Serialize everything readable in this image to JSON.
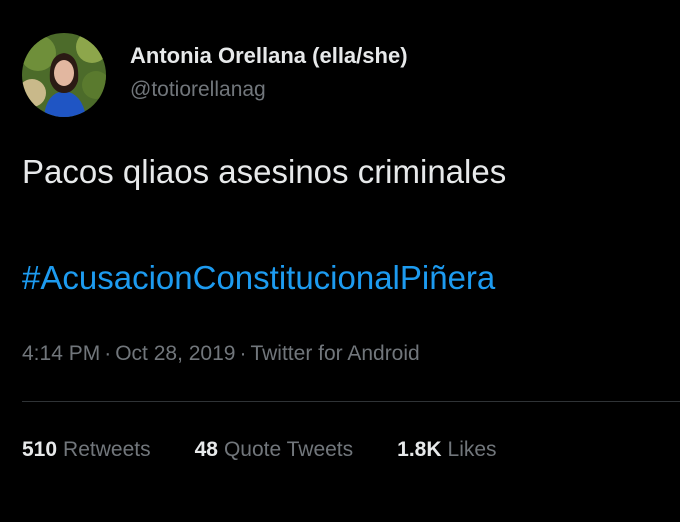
{
  "tweet": {
    "author": {
      "display_name": "Antonia Orellana (ella/she)",
      "handle": "@totiorellanag",
      "avatar_icon": "profile-photo"
    },
    "text": "Pacos qliaos asesinos criminales",
    "hashtag": "#AcusacionConstitucionalPiñera",
    "time": "4:14 PM",
    "separator": "·",
    "date": "Oct 28, 2019",
    "source": "Twitter for Android"
  },
  "stats": {
    "retweets": {
      "count": "510",
      "label": "Retweets"
    },
    "quote_tweets": {
      "count": "48",
      "label": "Quote Tweets"
    },
    "likes": {
      "count": "1.8K",
      "label": "Likes"
    }
  },
  "colors": {
    "background": "#000000",
    "primary_text": "#e7e9ea",
    "secondary_text": "#71767b",
    "link": "#1d9bf0",
    "divider": "#2f3336"
  }
}
